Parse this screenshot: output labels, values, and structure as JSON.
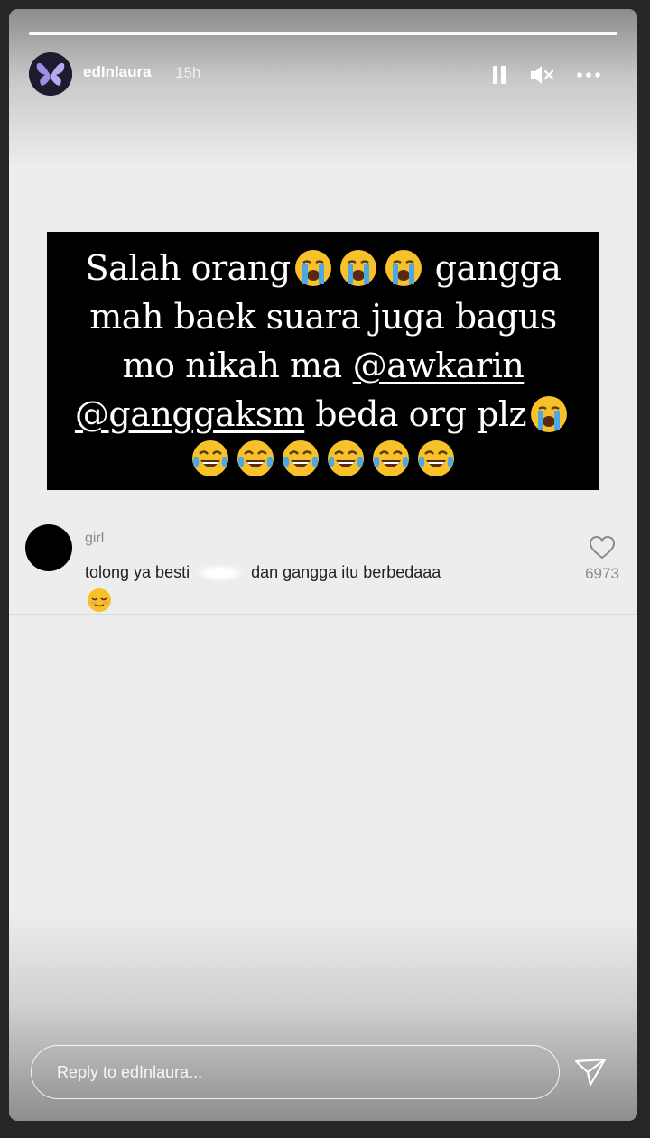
{
  "header": {
    "username": "edInlaura",
    "time_ago": "15h",
    "progress_segments": 1,
    "icons": [
      "avatar",
      "pause-icon",
      "mute-icon",
      "more-icon"
    ]
  },
  "caption": {
    "line1_text": "Salah orang",
    "line1_suffix": "gangga",
    "line2": "mah baek suara juga bagus",
    "line3_prefix": "mo nikah ma",
    "line3_mention": "@awkarin",
    "line4_mention": "@ganggaksm",
    "line4_suffix": "beda org plz",
    "emojis": [
      "loudly-crying-face",
      "tears-of-joy-face"
    ]
  },
  "comment": {
    "username": "girl",
    "text_before": "tolong ya besti",
    "text_after": "dan gangga itu berbedaaa",
    "likes": "6973",
    "emoji": "relieved-face"
  },
  "reply": {
    "placeholder": "Reply to edInlaura..."
  },
  "colors": {
    "story_bg": "#eeeded",
    "caption_bg": "#000000",
    "comment_meta": "#8a8a8a",
    "emoji_yellow": "#f7c12a",
    "tear_blue": "#4aa8e8"
  }
}
